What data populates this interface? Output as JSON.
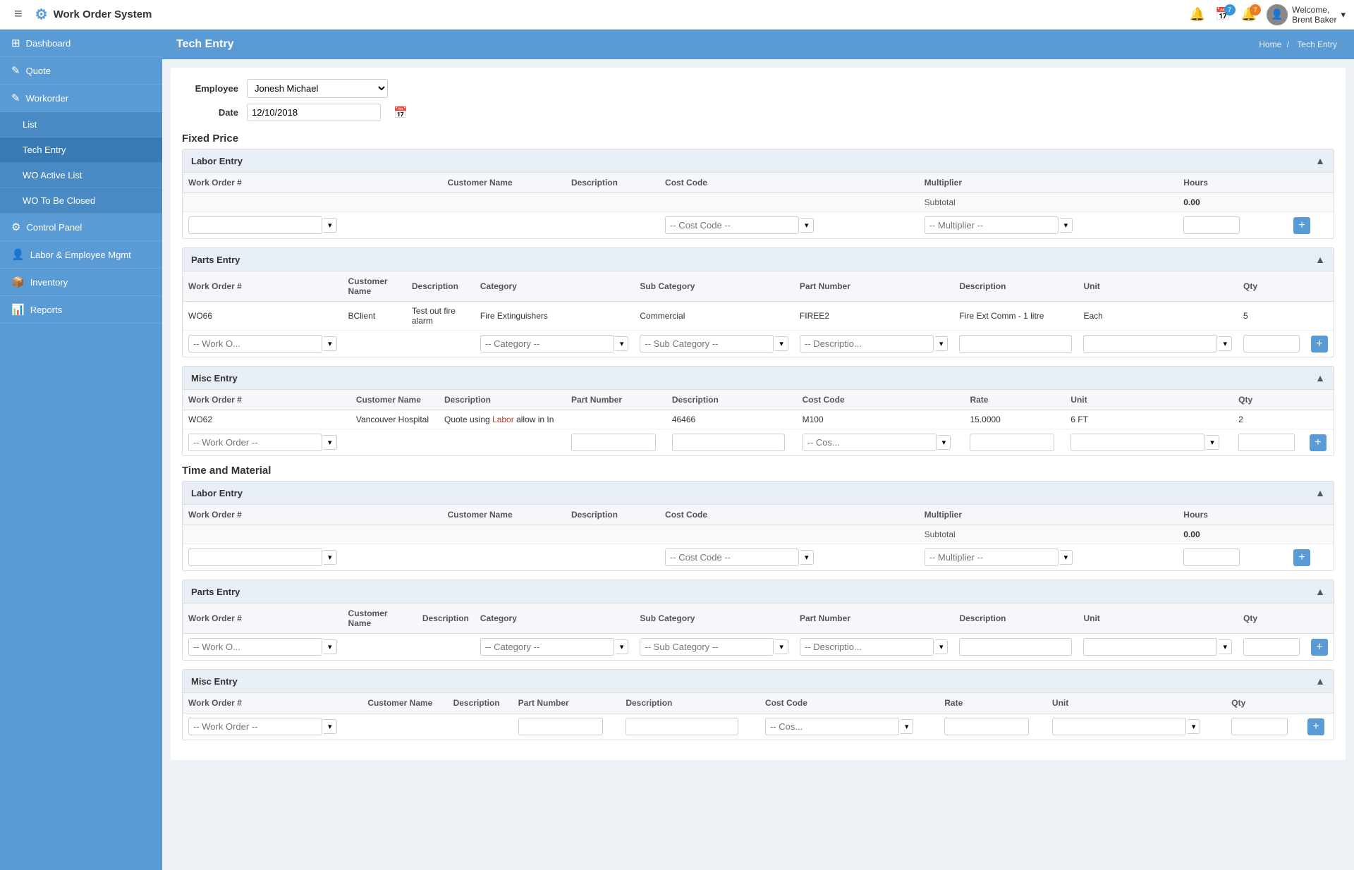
{
  "app": {
    "title": "Work Order System",
    "gear_icon": "⚙"
  },
  "navbar": {
    "hamburger": "≡",
    "notifications_count": "",
    "calendar_count": "7",
    "alerts_count": "7",
    "user_name": "Welcome,",
    "user_lastname": "Brent Baker",
    "chevron": "▾"
  },
  "sidebar": {
    "items": [
      {
        "label": "Dashboard",
        "icon": "⊞",
        "sub": false
      },
      {
        "label": "Quote",
        "icon": "✎",
        "sub": false
      },
      {
        "label": "Workorder",
        "icon": "✎",
        "sub": false
      },
      {
        "label": "List",
        "icon": "",
        "sub": true
      },
      {
        "label": "Tech Entry",
        "icon": "",
        "sub": true,
        "active": true
      },
      {
        "label": "WO Active List",
        "icon": "",
        "sub": true
      },
      {
        "label": "WO To Be Closed",
        "icon": "",
        "sub": true
      },
      {
        "label": "Control Panel",
        "icon": "⚙",
        "sub": false
      },
      {
        "label": "Labor & Employee Mgmt",
        "icon": "👤",
        "sub": false
      },
      {
        "label": "Inventory",
        "icon": "📦",
        "sub": false
      },
      {
        "label": "Reports",
        "icon": "📊",
        "sub": false
      }
    ]
  },
  "page": {
    "title": "Tech Entry",
    "breadcrumb_home": "Home",
    "breadcrumb_sep": "/",
    "breadcrumb_current": "Tech Entry"
  },
  "form": {
    "employee_label": "Employee",
    "employee_value": "Jonesh Michael",
    "date_label": "Date",
    "date_value": "12/10/2018"
  },
  "fixed_price": {
    "section_title": "Fixed Price",
    "labor_entry": {
      "title": "Labor Entry",
      "columns": [
        "Work Order #",
        "Customer Name",
        "Description",
        "Cost Code",
        "Multiplier",
        "Hours"
      ],
      "subtotal_label": "Subtotal",
      "subtotal_value": "0.00",
      "input_row": {
        "work_order_placeholder": "",
        "cost_code_placeholder": "-- Cost Code --",
        "multiplier_placeholder": "-- Multiplier --"
      }
    },
    "parts_entry": {
      "title": "Parts Entry",
      "columns": [
        "Work Order #",
        "Customer Name",
        "Description",
        "Category",
        "Sub Category",
        "Part Number",
        "Description",
        "Unit",
        "Qty"
      ],
      "data_rows": [
        {
          "work_order": "WO66",
          "customer_name": "BClient",
          "description": "Test out fire alarm",
          "category": "Fire Extinguishers",
          "sub_category": "Commercial",
          "part_number": "FIREE2",
          "part_description": "Fire Ext Comm - 1 litre",
          "unit": "Each",
          "qty": "5"
        }
      ],
      "input_row": {
        "work_order_placeholder": "-- Work O...",
        "category_placeholder": "-- Category --",
        "sub_category_placeholder": "-- Sub Category --",
        "description_placeholder": "-- Descriptio..."
      }
    },
    "misc_entry": {
      "title": "Misc Entry",
      "columns": [
        "Work Order #",
        "Customer Name",
        "Description",
        "Part Number",
        "Description",
        "Cost Code",
        "Rate",
        "Unit",
        "Qty"
      ],
      "data_rows": [
        {
          "work_order": "WO62",
          "customer_name": "Vancouver Hospital",
          "description": "Quote using Labor allow in In",
          "part_number": "",
          "part_description": "46466",
          "cost_code": "M100",
          "rate": "15.0000",
          "unit": "6 FT",
          "qty": "2"
        }
      ],
      "input_row": {
        "work_order_placeholder": "-- Work Order --",
        "cost_code_placeholder": "-- Cos..."
      }
    }
  },
  "time_and_material": {
    "section_title": "Time and Material",
    "labor_entry": {
      "title": "Labor Entry",
      "columns": [
        "Work Order #",
        "Customer Name",
        "Description",
        "Cost Code",
        "Multiplier",
        "Hours"
      ],
      "subtotal_label": "Subtotal",
      "subtotal_value": "0.00",
      "input_row": {
        "work_order_placeholder": "",
        "cost_code_placeholder": "-- Cost Code --",
        "multiplier_placeholder": "-- Multiplier --"
      }
    },
    "parts_entry": {
      "title": "Parts Entry",
      "columns": [
        "Work Order #",
        "Customer Name",
        "Description",
        "Category",
        "Sub Category",
        "Part Number",
        "Description",
        "Unit",
        "Qty"
      ],
      "input_row": {
        "work_order_placeholder": "-- Work O...",
        "category_placeholder": "-- Category --",
        "sub_category_placeholder": "-- Sub Category --",
        "description_placeholder": "-- Descriptio..."
      }
    },
    "misc_entry": {
      "title": "Misc Entry",
      "columns": [
        "Work Order #",
        "Customer Name",
        "Description",
        "Part Number",
        "Description",
        "Cost Code",
        "Rate",
        "Unit",
        "Qty"
      ],
      "input_row": {
        "work_order_placeholder": "-- Work Order --",
        "cost_code_placeholder": "-- Cos..."
      }
    }
  },
  "colors": {
    "primary": "#5b9bd5",
    "sidebar_bg": "#5b9bd5",
    "header_bg": "#5b9bd5"
  }
}
